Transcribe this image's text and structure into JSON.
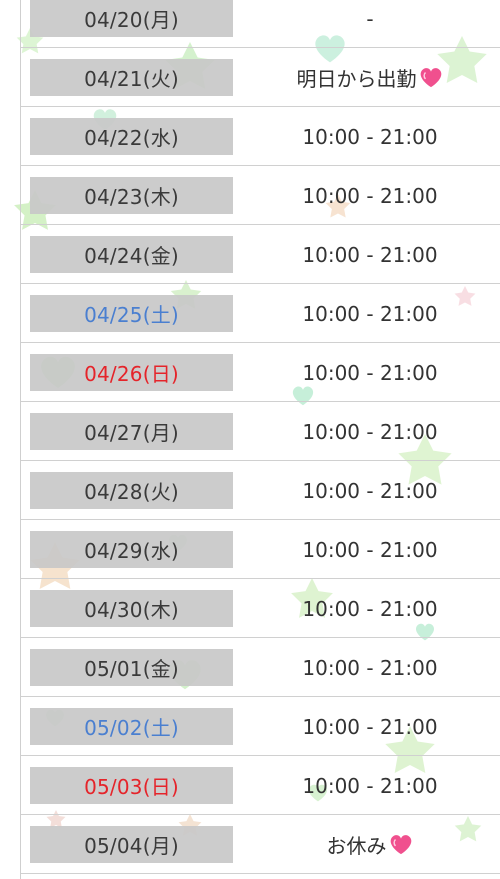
{
  "schedule": {
    "rows": [
      {
        "date": "04/20(月)",
        "day_type": "weekday",
        "hours": "-",
        "has_heart": false
      },
      {
        "date": "04/21(火)",
        "day_type": "weekday",
        "hours": "明日から出勤",
        "has_heart": true
      },
      {
        "date": "04/22(水)",
        "day_type": "weekday",
        "hours": "10:00 - 21:00",
        "has_heart": false
      },
      {
        "date": "04/23(木)",
        "day_type": "weekday",
        "hours": "10:00 - 21:00",
        "has_heart": false
      },
      {
        "date": "04/24(金)",
        "day_type": "weekday",
        "hours": "10:00 - 21:00",
        "has_heart": false
      },
      {
        "date": "04/25(土)",
        "day_type": "saturday",
        "hours": "10:00 - 21:00",
        "has_heart": false
      },
      {
        "date": "04/26(日)",
        "day_type": "sunday",
        "hours": "10:00 - 21:00",
        "has_heart": false
      },
      {
        "date": "04/27(月)",
        "day_type": "weekday",
        "hours": "10:00 - 21:00",
        "has_heart": false
      },
      {
        "date": "04/28(火)",
        "day_type": "weekday",
        "hours": "10:00 - 21:00",
        "has_heart": false
      },
      {
        "date": "04/29(水)",
        "day_type": "weekday",
        "hours": "10:00 - 21:00",
        "has_heart": false
      },
      {
        "date": "04/30(木)",
        "day_type": "weekday",
        "hours": "10:00 - 21:00",
        "has_heart": false
      },
      {
        "date": "05/01(金)",
        "day_type": "weekday",
        "hours": "10:00 - 21:00",
        "has_heart": false
      },
      {
        "date": "05/02(土)",
        "day_type": "saturday",
        "hours": "10:00 - 21:00",
        "has_heart": false
      },
      {
        "date": "05/03(日)",
        "day_type": "sunday",
        "hours": "10:00 - 21:00",
        "has_heart": false
      },
      {
        "date": "05/04(月)",
        "day_type": "weekday",
        "hours": "お休み",
        "has_heart": true
      }
    ]
  },
  "colors": {
    "saturday": "#4a7fd0",
    "sunday": "#e5242a",
    "weekday": "#3a3a3a",
    "date_cell_bg": "#c8c8c8",
    "heart": "#f0508e"
  },
  "icons": {
    "heart": "pink-heart-icon",
    "decoration": "pastel-star-and-heart-icons"
  }
}
